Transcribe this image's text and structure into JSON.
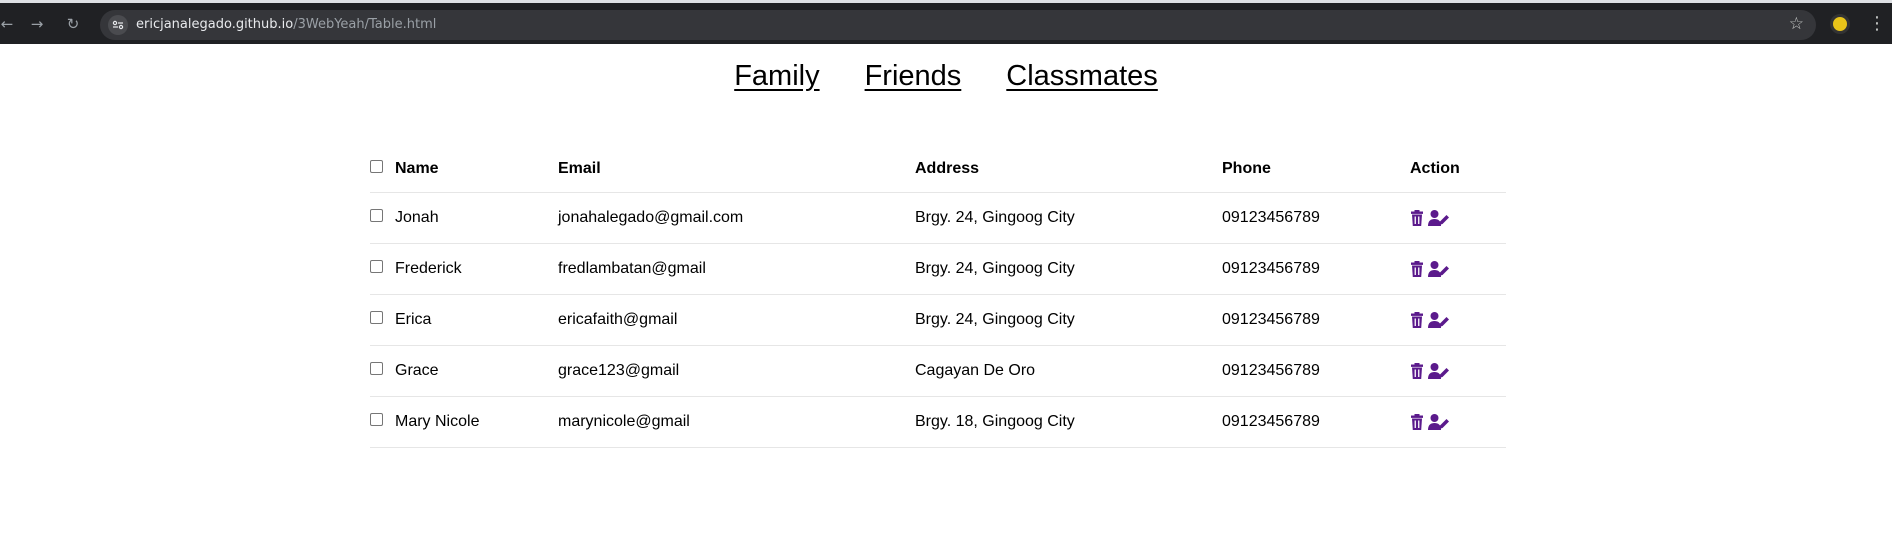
{
  "browser": {
    "url_host": "ericjanalegado.github.io",
    "url_path": "/3WebYeah/Table.html",
    "icons": [
      "back-icon",
      "forward-icon",
      "reload-icon",
      "site-info-icon",
      "bookmark-star-icon",
      "extension-icon",
      "menu-icon"
    ]
  },
  "nav": {
    "links": [
      "Family",
      "Friends",
      "Classmates"
    ]
  },
  "table": {
    "headers": {
      "name": "Name",
      "email": "Email",
      "address": "Address",
      "phone": "Phone",
      "action": "Action"
    },
    "rows": [
      {
        "name": "Jonah",
        "email": "jonahalegado@gmail.com",
        "address": "Brgy. 24, Gingoog City",
        "phone": "09123456789"
      },
      {
        "name": "Frederick",
        "email": "fredlambatan@gmail",
        "address": "Brgy. 24, Gingoog City",
        "phone": "09123456789"
      },
      {
        "name": "Erica",
        "email": "ericafaith@gmail",
        "address": "Brgy. 24, Gingoog City",
        "phone": "09123456789"
      },
      {
        "name": "Grace",
        "email": "grace123@gmail",
        "address": "Cagayan De Oro",
        "phone": "09123456789"
      },
      {
        "name": "Mary Nicole",
        "email": "marynicole@gmail",
        "address": "Brgy. 18, Gingoog City",
        "phone": "09123456789"
      }
    ],
    "action_icons": [
      "trash-icon",
      "edit-user-icon"
    ]
  },
  "colors": {
    "browser_bar": "#202124",
    "omnibox": "#35363a",
    "action_icon": "#5b1a8c"
  }
}
